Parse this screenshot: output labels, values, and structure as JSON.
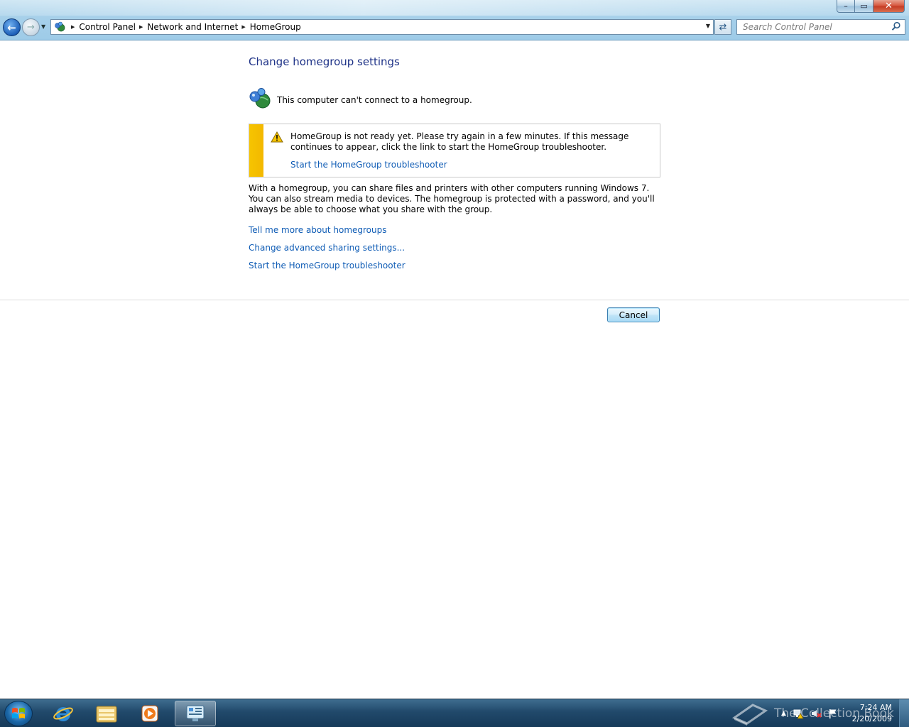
{
  "window": {
    "controls": {
      "minimize": "–",
      "maximize": "▭",
      "close": "✕"
    }
  },
  "nav": {
    "back_glyph": "←",
    "forward_glyph": "→",
    "dropdown_glyph": "▼"
  },
  "address": {
    "icon": "network-globe-icon",
    "breadcrumbs": [
      "Control Panel",
      "Network and Internet",
      "HomeGroup"
    ],
    "separator": "▶",
    "dropdown_glyph": "▼"
  },
  "refresh": {
    "glyph": "⇄"
  },
  "search": {
    "placeholder": "Search Control Panel"
  },
  "page": {
    "title": "Change homegroup settings",
    "status_text": "This computer can't connect to a homegroup.",
    "warning": {
      "message": "HomeGroup is not ready yet. Please try again in a few minutes. If this message continues to appear, click the link to start the HomeGroup troubleshooter.",
      "link": "Start the HomeGroup troubleshooter"
    },
    "description": "With a homegroup, you can share files and printers with other computers running Windows 7. You can also stream media to devices. The homegroup is protected with a password, and you'll always be able to choose what you share with the group.",
    "links": [
      "Tell me more about homegroups",
      "Change advanced sharing settings...",
      "Start the HomeGroup troubleshooter"
    ],
    "cancel_label": "Cancel"
  },
  "taskbar": {
    "clock_time": "7:24 AM",
    "clock_date": "2/20/2009",
    "watermark": "The Collection Book",
    "colors": {
      "accent": "#1e3287",
      "link": "#0f5cb5",
      "warning": "#f6c400"
    }
  }
}
